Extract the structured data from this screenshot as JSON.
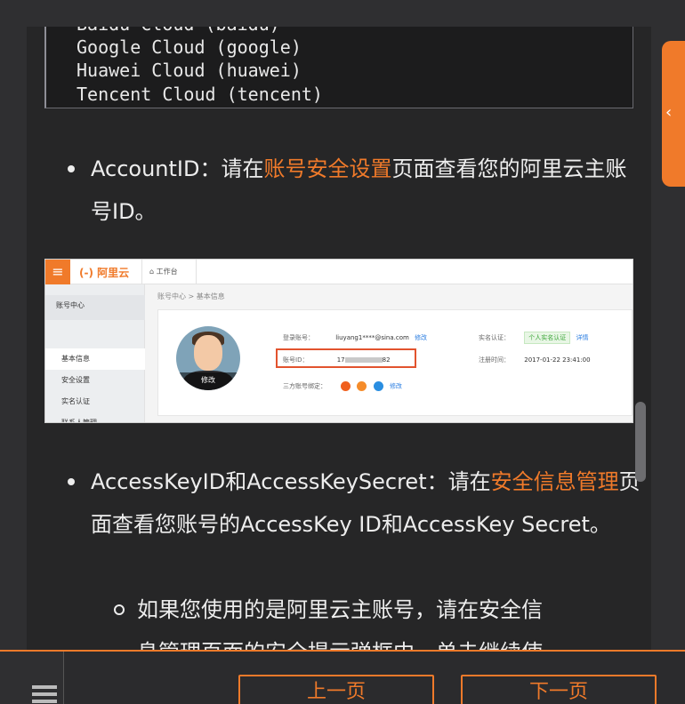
{
  "code_lines": [
    "Baidu Cloud (baidu)",
    "Google Cloud (google)",
    "Huawei Cloud (huawei)",
    "Tencent Cloud (tencent)"
  ],
  "bullet1": {
    "prefix": "AccountID：请在",
    "link": "账号安全设置",
    "suffix": "页面查看您的阿里云主账号ID。"
  },
  "screenshot": {
    "menu_icon": "menu-icon",
    "logo": "(-) 阿里云",
    "work_tab": "工作台",
    "sidebar_title": "账号中心",
    "sidebar_items": [
      "基本信息",
      "安全设置",
      "实名认证",
      "联系人管理"
    ],
    "breadcrumb": "账号中心  >  基本信息",
    "avatar_edit": "修改",
    "login_label": "登录账号：",
    "login_value": "liuyang1****@sina.com",
    "login_edit": "修改",
    "account_id_label": "账号ID：",
    "account_id_prefix": "17",
    "account_id_suffix": "82",
    "thirdparty_label": "三方账号绑定：",
    "thirdparty_edit": "修改",
    "realname_label": "实名认证：",
    "realname_badge": "个人实名认证",
    "realname_detail": "详情",
    "register_label": "注册时间：",
    "register_value": "2017-01-22 23:41:00"
  },
  "bullet2": {
    "prefix": "AccessKeyID和AccessKeySecret：请在",
    "link": "安全信息管理",
    "suffix": "页面查看您账号的AccessKey ID和AccessKey Secret。"
  },
  "sub_bullet": {
    "line1": "如果您使用的是阿里云主账号，请在安全信",
    "line2": "息管理页面的安全提示弹框中，单击继续使"
  },
  "nav": {
    "prev_label": "上一页",
    "next_label": "下一页",
    "toc_icon": "toc-icon",
    "side_tab_icon": "chevron-left-icon"
  },
  "colors": {
    "accent": "#f07a2a",
    "background": "#262627"
  }
}
